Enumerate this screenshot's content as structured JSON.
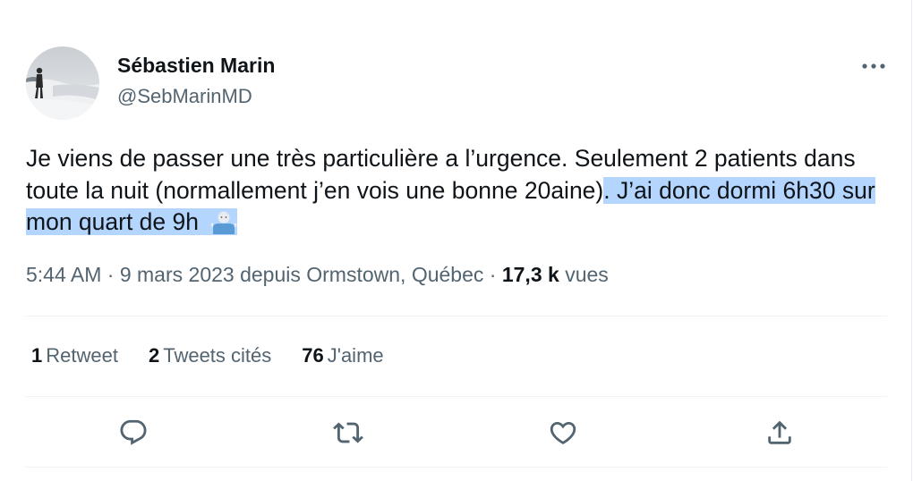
{
  "author": {
    "name": "Sébastien Marin",
    "handle": "@SebMarinMD",
    "avatar_icon": "avatar-photo-snow-walker"
  },
  "tweet": {
    "text_before_selection": "Je viens de passer une très particulière a l’urgence. Seulement 2 patients dans toute la nuit (normallement j’en vois une bonne 20aine)",
    "text_selected": ". J’ai donc dormi 6h30 sur mon quart de 9h",
    "emoji": "man-shrugging-emoji",
    "selection_color": "#b4d5fe"
  },
  "meta": {
    "time": "5:44 AM",
    "separator": "·",
    "date": "9 mars 2023",
    "location": "depuis Ormstown, Québec",
    "views_count": "17,3 k",
    "views_label": "vues"
  },
  "stats": {
    "retweets_count": "1",
    "retweets_label": "Retweet",
    "quotes_count": "2",
    "quotes_label": "Tweets cités",
    "likes_count": "76",
    "likes_label": "J'aime"
  },
  "actions": {
    "icons": [
      "reply-icon",
      "retweet-icon",
      "like-icon",
      "share-icon"
    ],
    "icon_color": "#536471"
  },
  "colors": {
    "text_primary": "#0f1419",
    "text_secondary": "#536471",
    "divider": "#eff3f4"
  }
}
